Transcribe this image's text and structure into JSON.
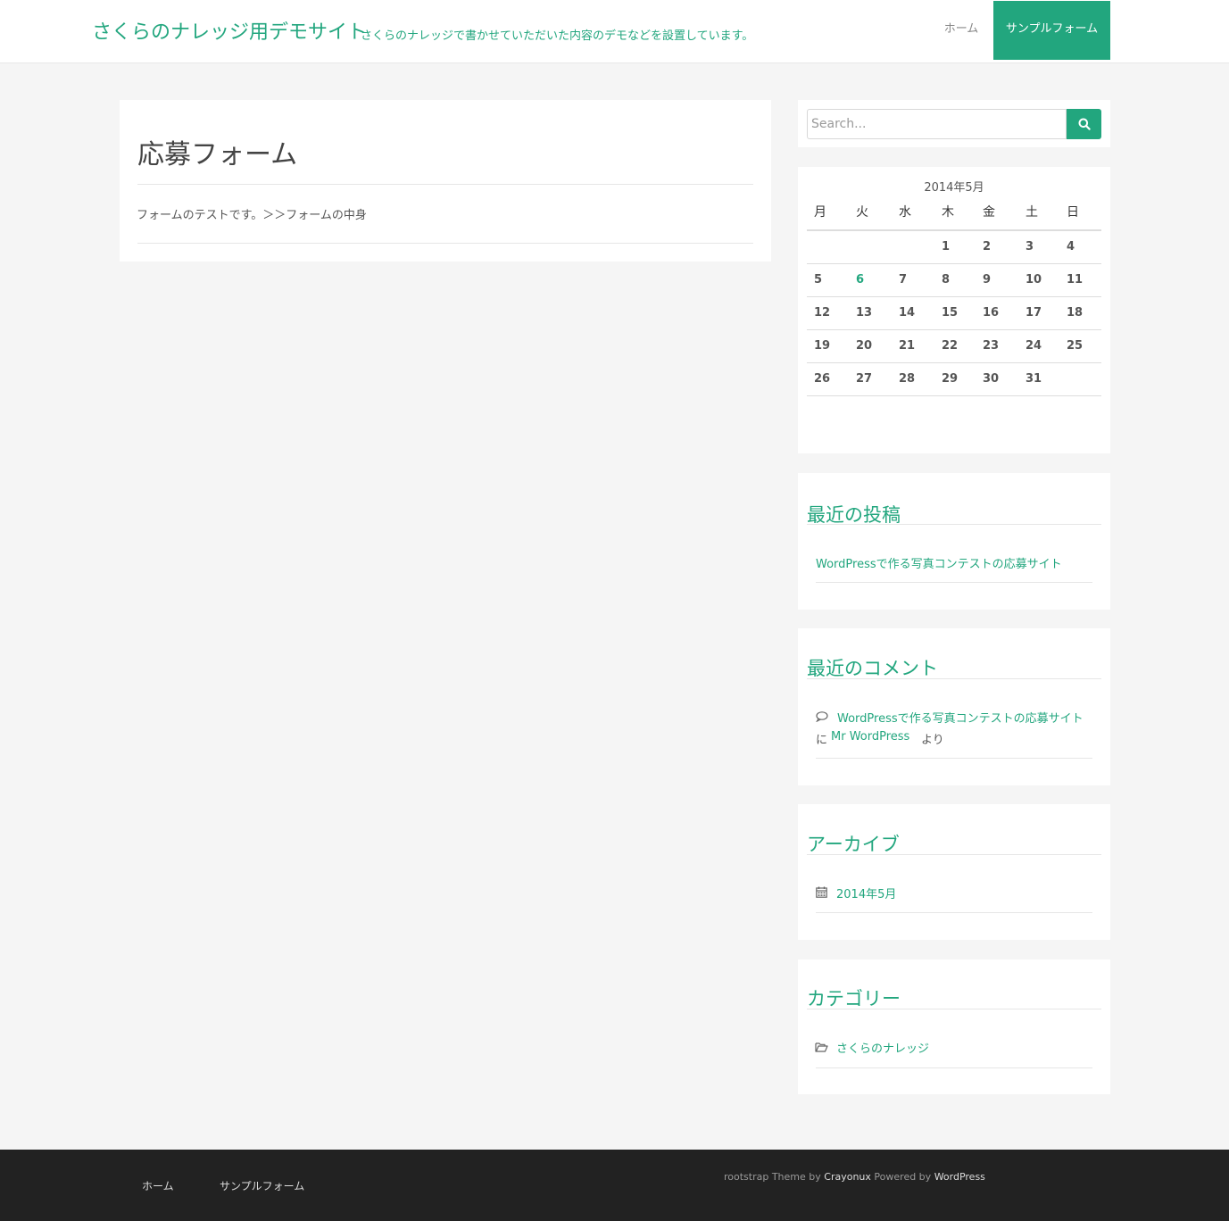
{
  "header": {
    "site_title": "さくらのナレッジ用デモサイト",
    "site_description": "さくらのナレッジで書かせていただいた内容のデモなどを設置しています。",
    "nav": [
      {
        "label": "ホーム",
        "active": false
      },
      {
        "label": "サンプルフォーム",
        "active": true
      }
    ]
  },
  "article": {
    "title": "応募フォーム",
    "body": "フォームのテストです。＞＞フォームの中身"
  },
  "search": {
    "placeholder": "Search...",
    "value": "",
    "icon": "search-icon"
  },
  "calendar": {
    "caption": "2014年5月",
    "weekdays": [
      "月",
      "火",
      "水",
      "木",
      "金",
      "土",
      "日"
    ],
    "weeks": [
      [
        "",
        "",
        "",
        "1",
        "2",
        "3",
        "4"
      ],
      [
        "5",
        "6",
        "7",
        "8",
        "9",
        "10",
        "11"
      ],
      [
        "12",
        "13",
        "14",
        "15",
        "16",
        "17",
        "18"
      ],
      [
        "19",
        "20",
        "21",
        "22",
        "23",
        "24",
        "25"
      ],
      [
        "26",
        "27",
        "28",
        "29",
        "30",
        "31",
        ""
      ]
    ],
    "linked_day": "6"
  },
  "recent_posts": {
    "title": "最近の投稿",
    "items": [
      "WordPressで作る写真コンテストの応募サイト"
    ]
  },
  "recent_comments": {
    "title": "最近のコメント",
    "post_link": "WordPressで作る写真コンテストの応募サイト",
    "connector": "に",
    "author": "Mr WordPress",
    "suffix": "より",
    "icon": "comment-icon"
  },
  "archives": {
    "title": "アーカイブ",
    "items": [
      "2014年5月"
    ],
    "icon": "calendar-icon"
  },
  "categories": {
    "title": "カテゴリー",
    "items": [
      "さくらのナレッジ"
    ],
    "icon": "folder-icon"
  },
  "footer": {
    "nav": [
      "ホーム",
      "サンプルフォーム"
    ],
    "credit_theme": "rootstrap Theme by",
    "credit_author": "Crayonux",
    "credit_powered": "Powered by",
    "credit_wp": "WordPress"
  },
  "colors": {
    "accent": "#22a67e",
    "footer_bg": "#222222",
    "page_bg": "#f5f5f5"
  }
}
